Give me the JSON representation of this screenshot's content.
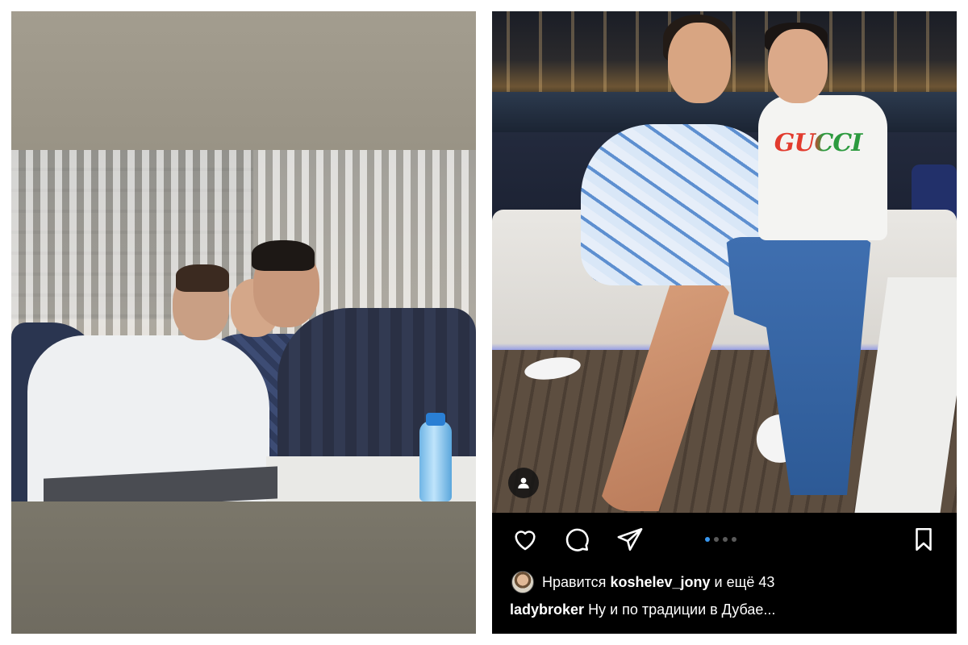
{
  "left_panel": {
    "image_description_icon": "photo"
  },
  "post": {
    "icons": {
      "like": "heart-icon",
      "comment": "comment-icon",
      "share": "send-icon",
      "save": "bookmark-icon",
      "tagged": "user-icon"
    },
    "carousel": {
      "count": 4,
      "active_index": 0
    },
    "likes": {
      "prefix": "Нравится",
      "username": "koshelev_jony",
      "suffix": "и ещё 43"
    },
    "caption": {
      "username": "ladybroker",
      "text": "Ну и по традиции в Дубае..."
    },
    "colors": {
      "background": "#000000",
      "active_dot": "#3897f0",
      "inactive_dot": "#5a5a5a"
    }
  }
}
